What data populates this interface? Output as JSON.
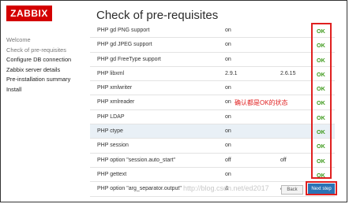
{
  "logo": "ZABBIX",
  "page_title": "Check of pre-requisites",
  "sidebar": {
    "items": [
      {
        "label": "Welcome"
      },
      {
        "label": "Check of pre-requisites"
      },
      {
        "label": "Configure DB connection"
      },
      {
        "label": "Zabbix server details"
      },
      {
        "label": "Pre-installation summary"
      },
      {
        "label": "Install"
      }
    ]
  },
  "checks": [
    {
      "name": "PHP gd PNG support",
      "current": "on",
      "required": "",
      "status": "OK"
    },
    {
      "name": "PHP gd JPEG support",
      "current": "on",
      "required": "",
      "status": "OK"
    },
    {
      "name": "PHP gd FreeType support",
      "current": "on",
      "required": "",
      "status": "OK"
    },
    {
      "name": "PHP libxml",
      "current": "2.9.1",
      "required": "2.6.15",
      "status": "OK"
    },
    {
      "name": "PHP xmlwriter",
      "current": "on",
      "required": "",
      "status": "OK"
    },
    {
      "name": "PHP xmlreader",
      "current": "on",
      "required": "",
      "status": "OK"
    },
    {
      "name": "PHP LDAP",
      "current": "on",
      "required": "",
      "status": "OK"
    },
    {
      "name": "PHP ctype",
      "current": "on",
      "required": "",
      "status": "OK"
    },
    {
      "name": "PHP session",
      "current": "on",
      "required": "",
      "status": "OK"
    },
    {
      "name": "PHP option \"session.auto_start\"",
      "current": "off",
      "required": "off",
      "status": "OK"
    },
    {
      "name": "PHP gettext",
      "current": "on",
      "required": "",
      "status": "OK"
    },
    {
      "name": "PHP option \"arg_separator.output\"",
      "current": "&",
      "required": "&",
      "status": "OK"
    }
  ],
  "annotation": "确认都是OK的状态",
  "watermark": "http://blog.csdn.net/ed2017",
  "buttons": {
    "back": "Back",
    "next": "Next step"
  },
  "colors": {
    "ok": "#3e9b1d",
    "highlight_box": "#e02020",
    "brand": "#d40000",
    "primary_button": "#2b73b5"
  }
}
